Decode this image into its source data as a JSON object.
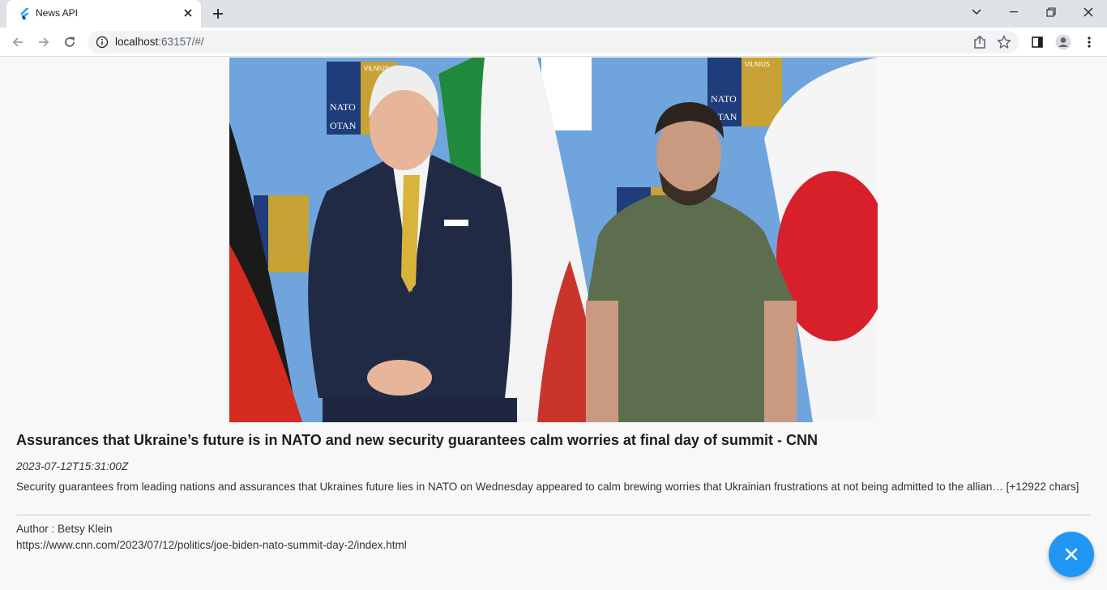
{
  "browser": {
    "tab": {
      "title": "News API"
    },
    "address": {
      "host": "localhost",
      "rest": ":63157/#/"
    }
  },
  "article": {
    "headline": "Assurances that Ukraine’s future is in NATO and new security guarantees calm worries at final day of summit - CNN",
    "published_at": "2023-07-12T15:31:00Z",
    "description": "Security guarantees from leading nations and assurances that Ukraines future lies in NATO on Wednesday appeared to calm brewing worries that Ukrainian frustrations at not being admitted to the allian… [+12922 chars]",
    "author_line": "Author : Betsy Klein",
    "url": "https://www.cnn.com/2023/07/12/politics/joe-biden-nato-summit-day-2/index.html",
    "backdrop_text": {
      "nato": "NATO",
      "otan": "OTAN",
      "vilnius": "VILNIUS"
    }
  },
  "fab": {
    "icon": "close-icon",
    "color": "#2196f3"
  },
  "colors": {
    "accent": "#2196f3",
    "flutter": "#42a5f5"
  }
}
